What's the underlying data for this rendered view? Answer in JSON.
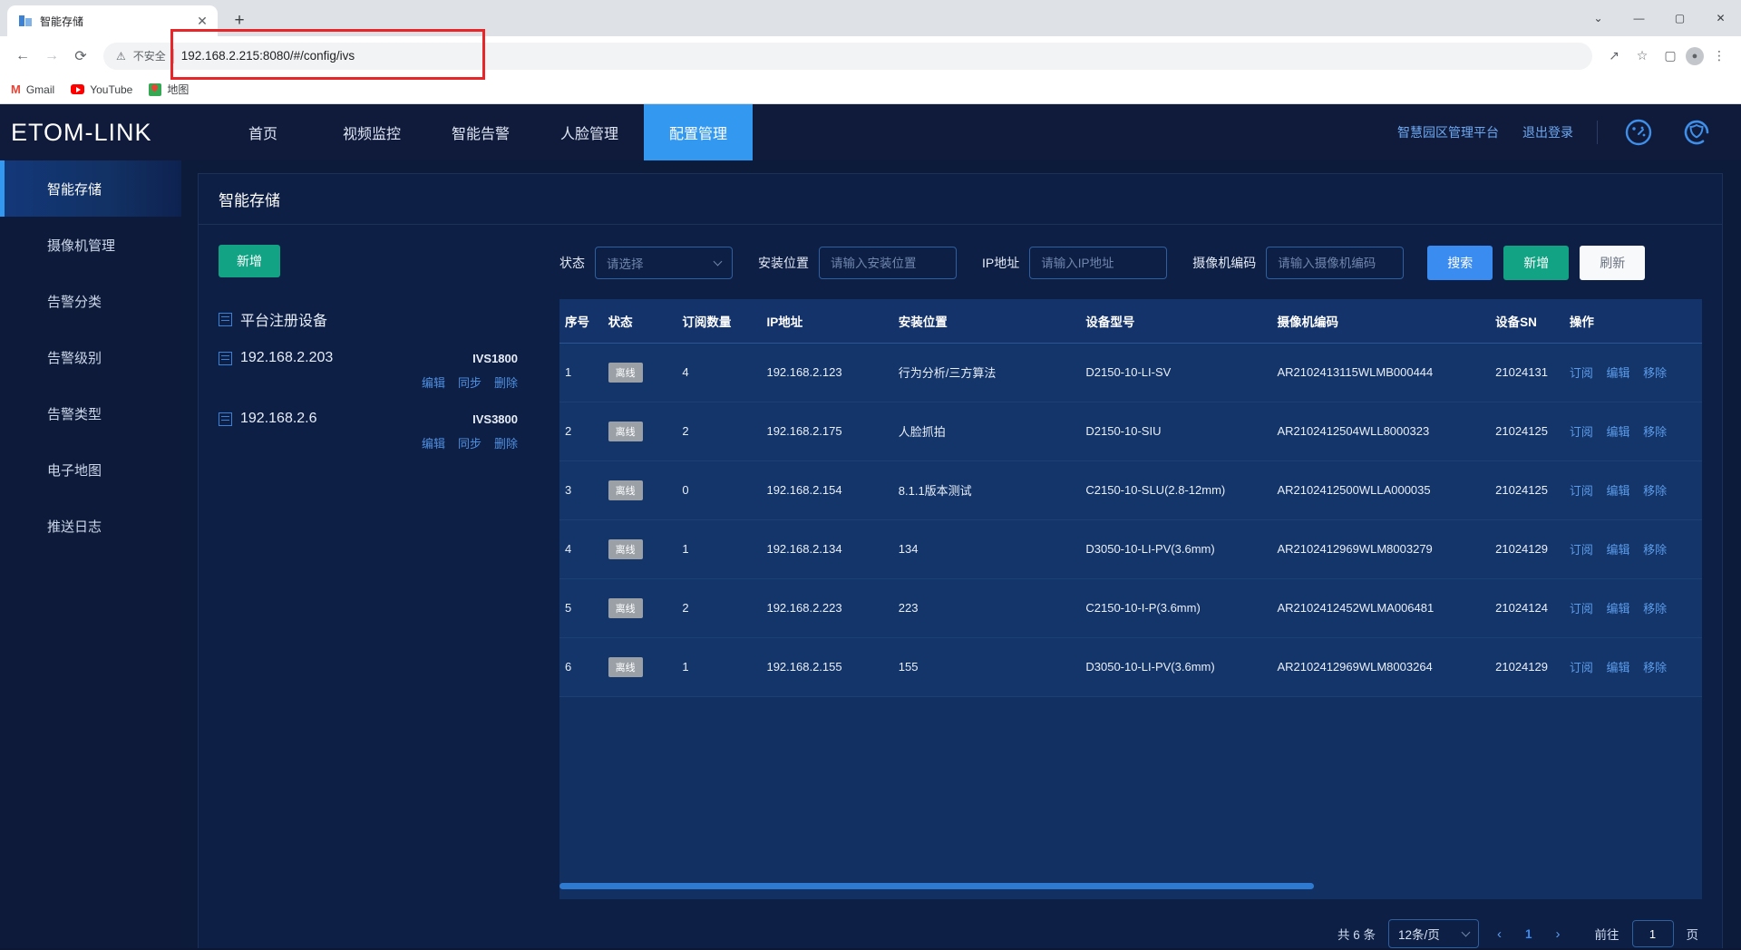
{
  "browser": {
    "tab_title": "智能存储",
    "new_tab": "+",
    "close": "✕",
    "minimize": "—",
    "maximize": "▢",
    "window_close": "✕",
    "chevron": "⌄",
    "back": "←",
    "forward": "→",
    "reload": "⟳",
    "warn_icon": "⚠",
    "not_secure": "不安全",
    "url": "192.168.2.215:8080/#/config/ivs",
    "share_icon": "↗",
    "star_icon": "☆",
    "sidepanel_icon": "▢",
    "profile_icon": "●",
    "menu_icon": "⋮",
    "bookmarks": [
      {
        "label": "Gmail",
        "icon": "gmail-icon"
      },
      {
        "label": "YouTube",
        "icon": "youtube-icon"
      },
      {
        "label": "地图",
        "icon": "maps-icon"
      }
    ]
  },
  "topnav": {
    "logo": "ETOM-LINK",
    "tabs": [
      {
        "label": "首页",
        "active": false
      },
      {
        "label": "视频监控",
        "active": false
      },
      {
        "label": "智能告警",
        "active": false
      },
      {
        "label": "人脸管理",
        "active": false
      },
      {
        "label": "配置管理",
        "active": true
      }
    ],
    "platform_link": "智慧园区管理平台",
    "logout_link": "退出登录",
    "icons": [
      "dashboard-gauge-icon",
      "shield-eye-icon"
    ]
  },
  "sidebar": {
    "items": [
      {
        "label": "智能存储",
        "active": true
      },
      {
        "label": "摄像机管理",
        "active": false
      },
      {
        "label": "告警分类",
        "active": false
      },
      {
        "label": "告警级别",
        "active": false
      },
      {
        "label": "告警类型",
        "active": false
      },
      {
        "label": "电子地图",
        "active": false
      },
      {
        "label": "推送日志",
        "active": false
      }
    ]
  },
  "panel": {
    "title": "智能存储"
  },
  "tree": {
    "add_button": "新增",
    "nodes": [
      {
        "label": "平台注册设备",
        "model": "",
        "actions": []
      },
      {
        "label": "192.168.2.203",
        "model": "IVS1800",
        "actions": [
          "编辑",
          "同步",
          "删除"
        ]
      },
      {
        "label": "192.168.2.6",
        "model": "IVS3800",
        "actions": [
          "编辑",
          "同步",
          "删除"
        ]
      }
    ]
  },
  "filters": {
    "status_label": "状态",
    "status_value": "请选择",
    "location_label": "安装位置",
    "location_placeholder": "请输入安装位置",
    "location_value": "",
    "ip_label": "IP地址",
    "ip_placeholder": "请输入IP地址",
    "ip_value": "",
    "camera_label": "摄像机编码",
    "camera_placeholder": "请输入摄像机编码",
    "camera_value": "",
    "search_button": "搜索",
    "add_button": "新增",
    "refresh_button": "刷新"
  },
  "table": {
    "headers": [
      "序号",
      "状态",
      "订阅数量",
      "IP地址",
      "安装位置",
      "设备型号",
      "摄像机编码",
      "设备SN",
      "操作"
    ],
    "row_actions": [
      "订阅",
      "编辑",
      "移除"
    ],
    "rows": [
      {
        "index": "1",
        "status": "离线",
        "subs": "4",
        "ip": "192.168.2.123",
        "location": "行为分析/三方算法",
        "model": "D2150-10-LI-SV",
        "camera_code": "AR2102413115WLMB000444",
        "sn": "21024131"
      },
      {
        "index": "2",
        "status": "离线",
        "subs": "2",
        "ip": "192.168.2.175",
        "location": "人脸抓拍",
        "model": "D2150-10-SIU",
        "camera_code": "AR2102412504WLL8000323",
        "sn": "21024125"
      },
      {
        "index": "3",
        "status": "离线",
        "subs": "0",
        "ip": "192.168.2.154",
        "location": "8.1.1版本测试",
        "model": "C2150-10-SLU(2.8-12mm)",
        "camera_code": "AR2102412500WLLA000035",
        "sn": "21024125"
      },
      {
        "index": "4",
        "status": "离线",
        "subs": "1",
        "ip": "192.168.2.134",
        "location": "134",
        "model": "D3050-10-LI-PV(3.6mm)",
        "camera_code": "AR2102412969WLM8003279",
        "sn": "21024129"
      },
      {
        "index": "5",
        "status": "离线",
        "subs": "2",
        "ip": "192.168.2.223",
        "location": "223",
        "model": "C2150-10-I-P(3.6mm)",
        "camera_code": "AR2102412452WLMA006481",
        "sn": "21024124"
      },
      {
        "index": "6",
        "status": "离线",
        "subs": "1",
        "ip": "192.168.2.155",
        "location": "155",
        "model": "D3050-10-LI-PV(3.6mm)",
        "camera_code": "AR2102412969WLM8003264",
        "sn": "21024129"
      }
    ]
  },
  "pagination": {
    "total": "共 6 条",
    "page_size": "12条/页",
    "prev": "‹",
    "current_page": "1",
    "next": "›",
    "goto_label": "前往",
    "goto_value": "1",
    "page_unit": "页"
  },
  "colors": {
    "accent_blue": "#3398f0",
    "green": "#11a383",
    "link_blue": "#5b9bea",
    "nav_bg": "#101b3c",
    "table_row": "#143569",
    "badge_gray": "#9aa0a6",
    "annotation_red": "#e8262a"
  }
}
